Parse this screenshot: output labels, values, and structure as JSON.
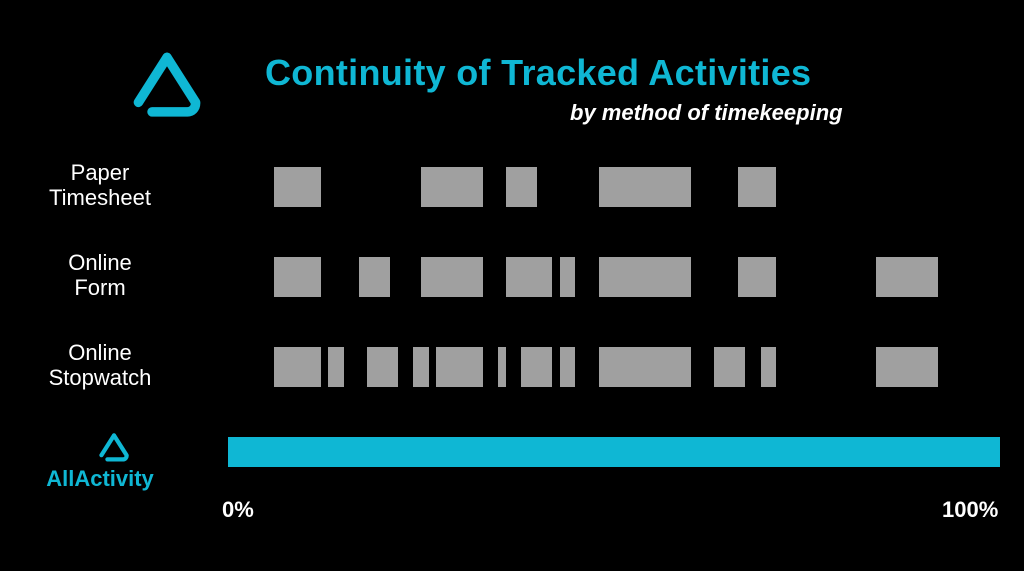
{
  "title": "Continuity of Tracked Activities",
  "subtitle": "by method of timekeeping",
  "axis": {
    "min_label": "0%",
    "max_label": "100%"
  },
  "rows": {
    "paper": {
      "label_line1": "Paper",
      "label_line2": "Timesheet"
    },
    "form": {
      "label_line1": "Online",
      "label_line2": "Form"
    },
    "stopwatch": {
      "label_line1": "Online",
      "label_line2": "Stopwatch"
    },
    "allactivity": {
      "label": "AllActivity"
    }
  },
  "chart_data": {
    "type": "bar",
    "title": "Continuity of Tracked Activities",
    "subtitle": "by method of timekeeping",
    "xlabel": "",
    "ylabel": "",
    "xlim": [
      0,
      100
    ],
    "x_ticks": [
      0,
      100
    ],
    "categories": [
      "Paper Timesheet",
      "Online Form",
      "Online Stopwatch",
      "AllActivity"
    ],
    "series": [
      {
        "name": "Paper Timesheet",
        "color": "#A0A0A0",
        "segments": [
          {
            "start": 6,
            "end": 12
          },
          {
            "start": 25,
            "end": 33
          },
          {
            "start": 36,
            "end": 40
          },
          {
            "start": 48,
            "end": 60
          },
          {
            "start": 66,
            "end": 71
          }
        ]
      },
      {
        "name": "Online Form",
        "color": "#A0A0A0",
        "segments": [
          {
            "start": 6,
            "end": 12
          },
          {
            "start": 17,
            "end": 21
          },
          {
            "start": 25,
            "end": 33
          },
          {
            "start": 36,
            "end": 42
          },
          {
            "start": 43,
            "end": 45
          },
          {
            "start": 48,
            "end": 60
          },
          {
            "start": 66,
            "end": 71
          },
          {
            "start": 84,
            "end": 92
          }
        ]
      },
      {
        "name": "Online Stopwatch",
        "color": "#A0A0A0",
        "segments": [
          {
            "start": 6,
            "end": 12
          },
          {
            "start": 13,
            "end": 15
          },
          {
            "start": 18,
            "end": 22
          },
          {
            "start": 24,
            "end": 26
          },
          {
            "start": 27,
            "end": 33
          },
          {
            "start": 35,
            "end": 36
          },
          {
            "start": 38,
            "end": 42
          },
          {
            "start": 43,
            "end": 45
          },
          {
            "start": 48,
            "end": 60
          },
          {
            "start": 63,
            "end": 67
          },
          {
            "start": 69,
            "end": 71
          },
          {
            "start": 84,
            "end": 92
          }
        ]
      },
      {
        "name": "AllActivity",
        "color": "#0FB7D4",
        "segments": [
          {
            "start": 0,
            "end": 100
          }
        ]
      }
    ]
  }
}
